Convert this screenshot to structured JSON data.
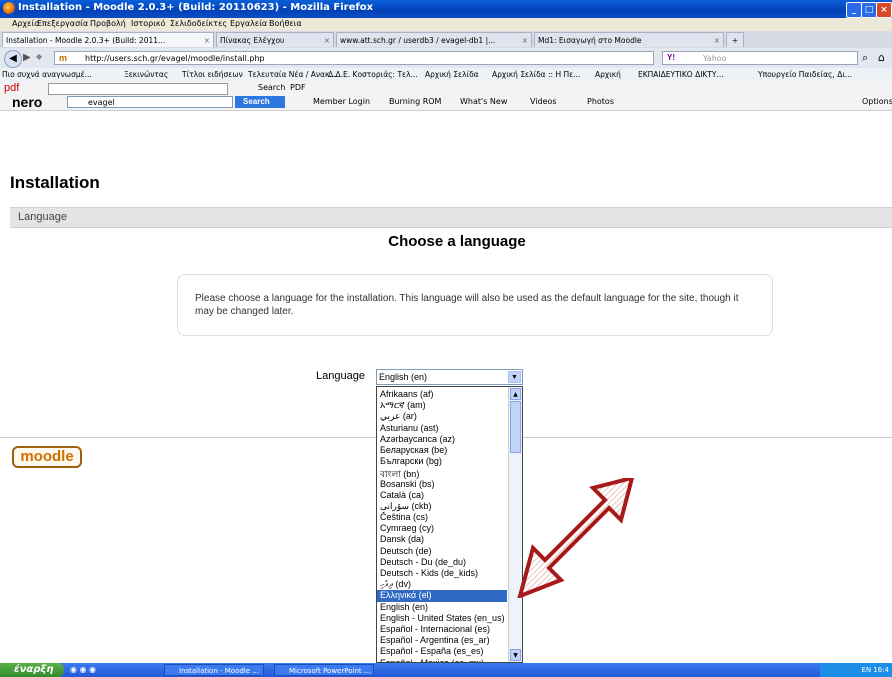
{
  "window": {
    "title": "Installation - Moodle 2.0.3+ (Build: 20110623) - Mozilla Firefox"
  },
  "menu": [
    "Αρχείο",
    "Επεξεργασία",
    "Προβολή",
    "Ιστορικό",
    "Σελιδοδείκτες",
    "Εργαλεία",
    "Βοήθεια"
  ],
  "tabs": [
    {
      "label": "Installation - Moodle 2.0.3+ (Build: 2011...",
      "active": true
    },
    {
      "label": "Πίνακας Ελέγχου",
      "active": false
    },
    {
      "label": "www.att.sch.gr / userdb3 / evagel-db1 |...",
      "active": false
    },
    {
      "label": "Md1: Εισαγωγή στο Moodle",
      "active": false
    }
  ],
  "nav": {
    "url": "http://users.sch.gr/evagel/moodle/install.php",
    "search_placeholder": "Yahoo"
  },
  "bookmarks": [
    "Πιο συχνά αναγνωσμέ...",
    "Ξεκινώντας",
    "Τίτλοι ειδήσεων",
    "Τελευταία Νέα / Ανακ...",
    "Δ.Δ.Ε. Κοστοριάς: Τελ...",
    "Αρχική Σελίδα",
    "Αρχική Σελίδα :: Η Πε...",
    "Αρχική",
    "ΕΚΠΑΙΔΕΥΤΙΚΟ ΔΙΚΤΥ...",
    "Υπουργείο Παιδείας, Δι..."
  ],
  "pdfbar": {
    "label": "pdf",
    "search": "Search",
    "pdf": "PDF"
  },
  "nerobar": {
    "logo": "nero",
    "search_value": "evagel",
    "search_button": "Search",
    "items": [
      "Member Login",
      "Burning ROM",
      "What's New",
      "Videos",
      "Photos"
    ],
    "options": "Options"
  },
  "page": {
    "heading": "Installation",
    "section": "Language",
    "title": "Choose a language",
    "info": "Please choose a language for the installation. This language will also be used as the default language for the site, though it may be changed later.",
    "language_label": "Language",
    "selected": "English (en)",
    "logo": "moodle"
  },
  "languages": [
    {
      "label": "Afrikaans (af)"
    },
    {
      "label": "አማርኛ (am)"
    },
    {
      "label": "عربي (ar)"
    },
    {
      "label": "Asturianu (ast)"
    },
    {
      "label": "Azərbaycanca (az)"
    },
    {
      "label": "Беларуская (be)"
    },
    {
      "label": "Български (bg)"
    },
    {
      "label": "বাংলা (bn)"
    },
    {
      "label": "Bosanski (bs)"
    },
    {
      "label": "Català (ca)"
    },
    {
      "label": "سۆرانی (ckb)"
    },
    {
      "label": "Čeština (cs)"
    },
    {
      "label": "Cymraeg (cy)"
    },
    {
      "label": "Dansk (da)"
    },
    {
      "label": "Deutsch (de)"
    },
    {
      "label": "Deutsch - Du (de_du)"
    },
    {
      "label": "Deutsch - Kids (de_kids)"
    },
    {
      "label": "ދިވެހި (dv)"
    },
    {
      "label": "Ελληνικά (el)",
      "selected": true
    },
    {
      "label": "English (en)"
    },
    {
      "label": "English - United States (en_us)"
    },
    {
      "label": "Español - Internacional (es)"
    },
    {
      "label": "Español - Argentina (es_ar)"
    },
    {
      "label": "Español - España (es_es)"
    },
    {
      "label": "Español - Mexico (es_mx)"
    }
  ],
  "taskbar": {
    "start": "έναρξη",
    "tasks": [
      "Installation - Moodle ...",
      "Microsoft PowerPoint ..."
    ],
    "tray": "EN 16:4"
  },
  "colors": {
    "arrow": "#b01818",
    "highlight": "#316ac5"
  }
}
